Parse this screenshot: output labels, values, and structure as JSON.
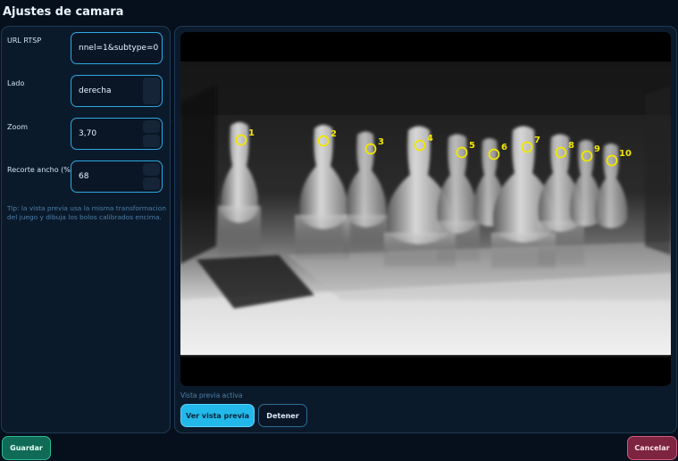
{
  "header": {
    "title": "Ajustes de camara"
  },
  "form": {
    "rtsp": {
      "label": "URL RTSP",
      "value": "nnel=1&subtype=0"
    },
    "side": {
      "label": "Lado",
      "value": "derecha"
    },
    "zoom": {
      "label": "Zoom",
      "value": "3,70"
    },
    "crop": {
      "label": "Recorte ancho (%)",
      "value": "68"
    },
    "tip": "Tip: la vista previa usa la misma transformacion del juego y dibuja los bolos calibrados encima."
  },
  "preview": {
    "status": "Vista previa activa",
    "pin_markers": [
      {
        "label": "1"
      },
      {
        "label": "2"
      },
      {
        "label": "3"
      },
      {
        "label": "4"
      },
      {
        "label": "5"
      },
      {
        "label": "6"
      },
      {
        "label": "7"
      },
      {
        "label": "8"
      },
      {
        "label": "9"
      },
      {
        "label": "10"
      }
    ],
    "marker_color": "#f2e600"
  },
  "buttons": {
    "preview": "Ver vista previa",
    "stop": "Detener",
    "save": "Guardar",
    "cancel": "Cancelar"
  },
  "colors": {
    "accent": "#22b8ea",
    "save": "#0f6b55",
    "cancel": "#7c2440"
  }
}
